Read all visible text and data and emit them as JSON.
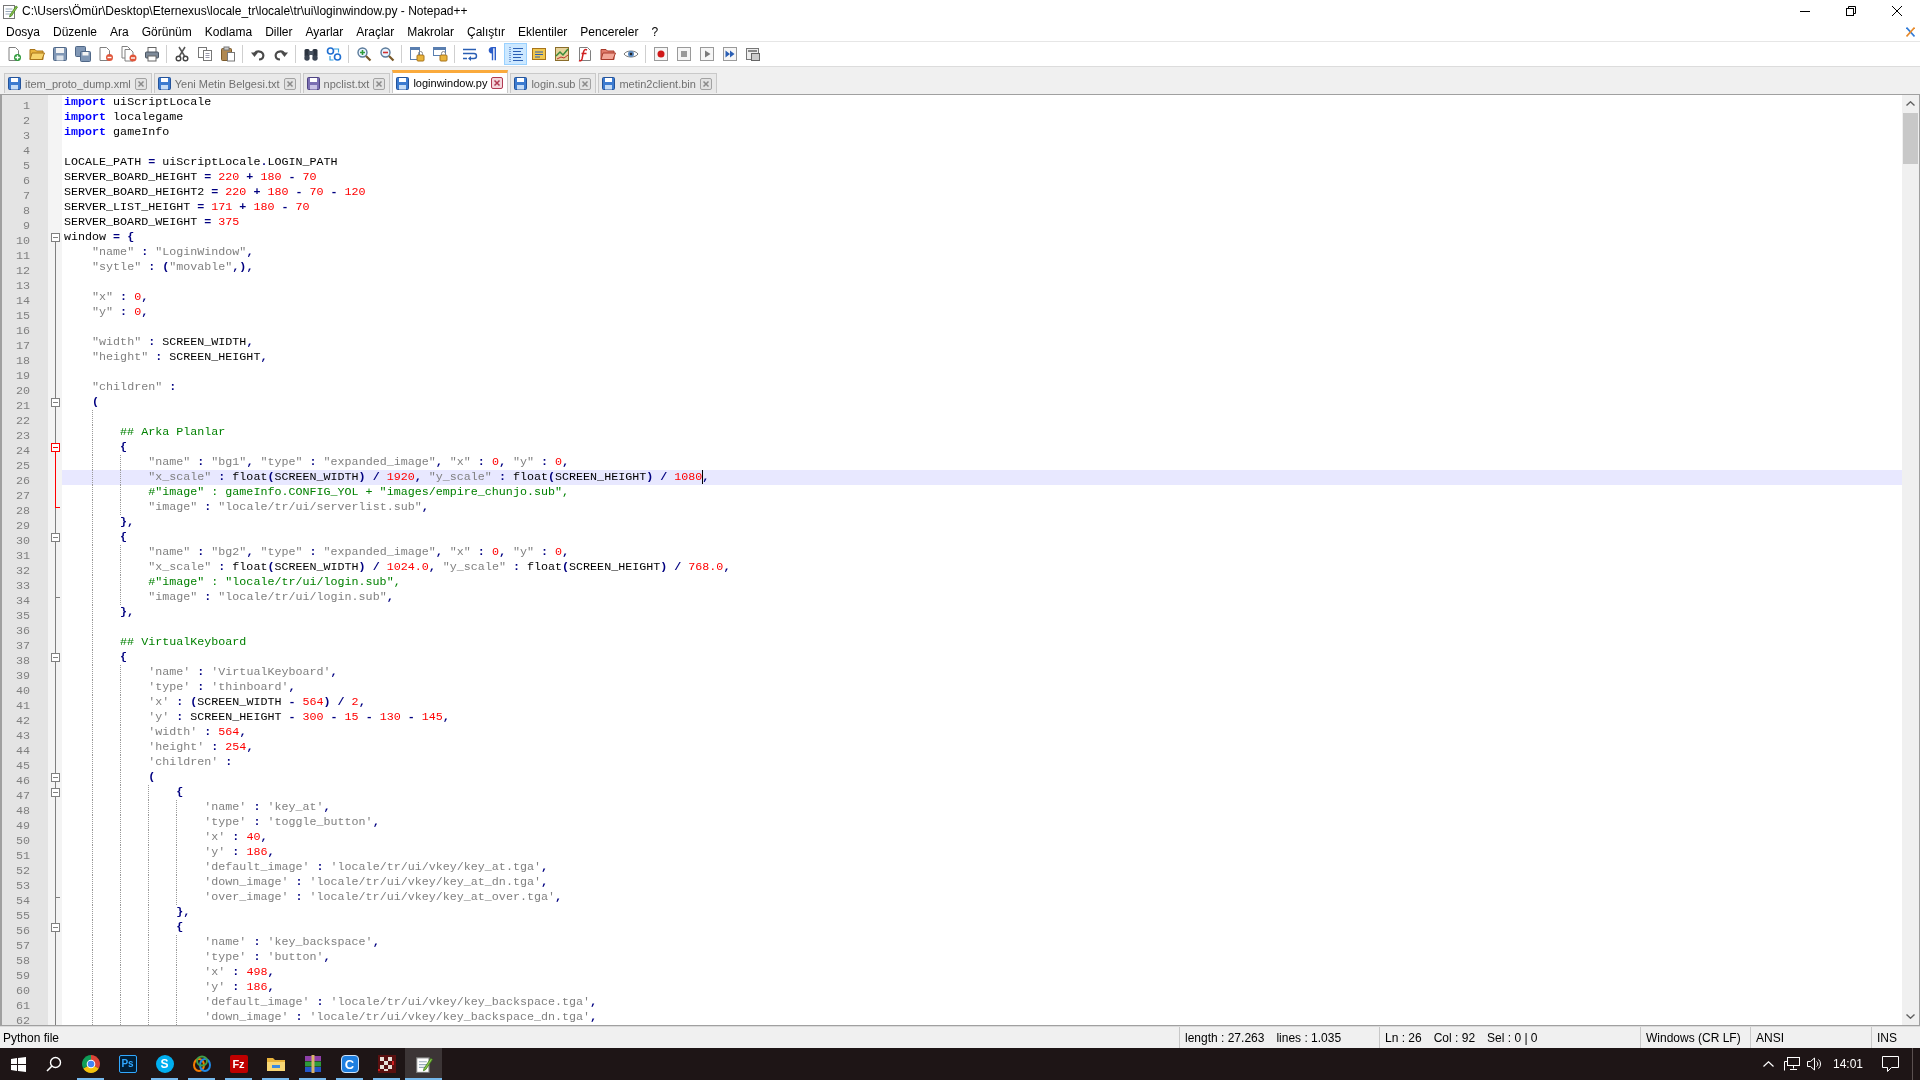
{
  "window": {
    "title": "C:\\Users\\Ömür\\Desktop\\Eternexus\\locale_tr\\locale\\tr\\ui\\loginwindow.py - Notepad++"
  },
  "menu": [
    "Dosya",
    "Düzenle",
    "Ara",
    "Görünüm",
    "Kodlama",
    "Diller",
    "Ayarlar",
    "Araçlar",
    "Makrolar",
    "Çalıştır",
    "Eklentiler",
    "Pencereler",
    "?"
  ],
  "toolbar": {
    "buttons": [
      {
        "kind": "icon",
        "selected": false
      },
      {
        "kind": "icon",
        "selected": false
      },
      {
        "kind": "icon",
        "selected": false
      },
      {
        "kind": "icon",
        "selected": false
      },
      {
        "kind": "icon",
        "selected": false
      },
      {
        "kind": "icon",
        "selected": false
      },
      {
        "kind": "icon",
        "selected": false
      },
      {
        "kind": "icon",
        "selected": false
      },
      {
        "kind": "icon",
        "selected": false
      },
      {
        "kind": "icon",
        "selected": false
      },
      {
        "kind": "icon",
        "selected": false
      },
      {
        "kind": "icon",
        "selected": false
      },
      {
        "kind": "icon",
        "selected": false
      },
      {
        "kind": "icon",
        "selected": false
      },
      {
        "kind": "icon",
        "selected": false
      },
      {
        "kind": "icon",
        "selected": false
      },
      {
        "kind": "icon",
        "selected": false
      },
      {
        "kind": "icon",
        "selected": false
      },
      {
        "kind": "icon",
        "selected": false
      },
      {
        "kind": "glyph",
        "text": "¶",
        "selected": false
      },
      {
        "kind": "icon",
        "selected": true
      },
      {
        "kind": "icon",
        "selected": false
      },
      {
        "kind": "icon",
        "selected": false
      },
      {
        "kind": "icon",
        "selected": false
      },
      {
        "kind": "icon",
        "selected": false
      },
      {
        "kind": "icon",
        "selected": false
      },
      {
        "kind": "icon",
        "selected": false
      },
      {
        "kind": "icon",
        "selected": false
      },
      {
        "kind": "icon",
        "selected": false
      },
      {
        "kind": "icon",
        "selected": false
      },
      {
        "kind": "icon",
        "selected": false
      }
    ]
  },
  "tabs": [
    {
      "label": "item_proto_dump.xml",
      "selected": false,
      "read_only": false
    },
    {
      "label": "Yeni Metin Belgesi.txt",
      "selected": false,
      "read_only": false
    },
    {
      "label": "npclist.txt",
      "selected": false,
      "read_only": true
    },
    {
      "label": "loginwindow.py",
      "selected": true,
      "read_only": false
    },
    {
      "label": "login.sub",
      "selected": false,
      "read_only": false
    },
    {
      "label": "metin2client.bin",
      "selected": false,
      "read_only": false
    }
  ],
  "editor": {
    "lines": [
      {
        "number": "1",
        "kind": "plain",
        "current": false,
        "tokens": [
          {
            "kind": "kw",
            "text": "import"
          },
          {
            "kind": "id",
            "text": " uiScriptLocale"
          }
        ]
      },
      {
        "number": "2",
        "kind": "plain",
        "current": false,
        "tokens": [
          {
            "kind": "kw",
            "text": "import"
          },
          {
            "kind": "id",
            "text": " localegame"
          }
        ]
      },
      {
        "number": "3",
        "kind": "plain",
        "current": false,
        "tokens": [
          {
            "kind": "kw",
            "text": "import"
          },
          {
            "kind": "id",
            "text": " gameInfo"
          }
        ]
      },
      {
        "number": "4",
        "kind": "plain",
        "current": false
      },
      {
        "number": "5",
        "kind": "plain",
        "current": false,
        "tokens": [
          {
            "kind": "id",
            "text": "LOCALE_PATH"
          },
          {
            "kind": "op",
            "text": " = "
          },
          {
            "kind": "id",
            "text": "uiScriptLocale"
          },
          {
            "kind": "op",
            "text": "."
          },
          {
            "kind": "id",
            "text": "LOGIN_PATH"
          }
        ]
      },
      {
        "number": "6",
        "kind": "plain",
        "current": false,
        "tokens": [
          {
            "kind": "id",
            "text": "SERVER_BOARD_HEIGHT"
          },
          {
            "kind": "op",
            "text": " = "
          },
          {
            "kind": "num",
            "text": "220"
          },
          {
            "kind": "op",
            "text": " + "
          },
          {
            "kind": "num",
            "text": "180"
          },
          {
            "kind": "op",
            "text": " - "
          },
          {
            "kind": "num",
            "text": "70"
          }
        ]
      },
      {
        "number": "7",
        "kind": "plain",
        "current": false,
        "tokens": [
          {
            "kind": "id",
            "text": "SERVER_BOARD_HEIGHT2"
          },
          {
            "kind": "op",
            "text": " = "
          },
          {
            "kind": "num",
            "text": "220"
          },
          {
            "kind": "op",
            "text": " + "
          },
          {
            "kind": "num",
            "text": "180"
          },
          {
            "kind": "op",
            "text": " - "
          },
          {
            "kind": "num",
            "text": "70"
          },
          {
            "kind": "op",
            "text": " - "
          },
          {
            "kind": "num",
            "text": "120"
          }
        ]
      },
      {
        "number": "8",
        "kind": "plain",
        "current": false,
        "tokens": [
          {
            "kind": "id",
            "text": "SERVER_LIST_HEIGHT"
          },
          {
            "kind": "op",
            "text": " = "
          },
          {
            "kind": "num",
            "text": "171"
          },
          {
            "kind": "op",
            "text": " + "
          },
          {
            "kind": "num",
            "text": "180"
          },
          {
            "kind": "op",
            "text": " - "
          },
          {
            "kind": "num",
            "text": "70"
          }
        ]
      },
      {
        "number": "9",
        "kind": "plain",
        "current": false,
        "tokens": [
          {
            "kind": "id",
            "text": "SERVER_BOARD_WEIGHT"
          },
          {
            "kind": "op",
            "text": " = "
          },
          {
            "kind": "num",
            "text": "375"
          }
        ]
      },
      {
        "number": "10",
        "kind": "foldstart",
        "fold_highlight": false,
        "current": false,
        "tokens": [
          {
            "kind": "id",
            "text": "window"
          },
          {
            "kind": "op",
            "text": " = {"
          }
        ]
      },
      {
        "number": "11",
        "kind": "foldline",
        "fold_highlight": false,
        "current": false,
        "tokens": [
          {
            "kind": "str",
            "text": "    \"name\""
          },
          {
            "kind": "op",
            "text": " : "
          },
          {
            "kind": "str",
            "text": "\"LoginWindow\""
          },
          {
            "kind": "op",
            "text": ","
          }
        ]
      },
      {
        "number": "12",
        "kind": "foldline",
        "fold_highlight": false,
        "current": false,
        "tokens": [
          {
            "kind": "str",
            "text": "    \"sytle\""
          },
          {
            "kind": "op",
            "text": " : ("
          },
          {
            "kind": "str",
            "text": "\"movable\""
          },
          {
            "kind": "op",
            "text": ",),"
          }
        ]
      },
      {
        "number": "13",
        "kind": "foldline",
        "fold_highlight": false,
        "current": false
      },
      {
        "number": "14",
        "kind": "foldline",
        "fold_highlight": false,
        "current": false,
        "tokens": [
          {
            "kind": "str",
            "text": "    \"x\""
          },
          {
            "kind": "op",
            "text": " : "
          },
          {
            "kind": "num",
            "text": "0"
          },
          {
            "kind": "op",
            "text": ","
          }
        ]
      },
      {
        "number": "15",
        "kind": "foldline",
        "fold_highlight": false,
        "current": false,
        "tokens": [
          {
            "kind": "str",
            "text": "    \"y\""
          },
          {
            "kind": "op",
            "text": " : "
          },
          {
            "kind": "num",
            "text": "0"
          },
          {
            "kind": "op",
            "text": ","
          }
        ]
      },
      {
        "number": "16",
        "kind": "foldline",
        "fold_highlight": false,
        "current": false
      },
      {
        "number": "17",
        "kind": "foldline",
        "fold_highlight": false,
        "current": false,
        "tokens": [
          {
            "kind": "str",
            "text": "    \"width\""
          },
          {
            "kind": "op",
            "text": " : "
          },
          {
            "kind": "id",
            "text": "SCREEN_WIDTH"
          },
          {
            "kind": "op",
            "text": ","
          }
        ]
      },
      {
        "number": "18",
        "kind": "foldline",
        "fold_highlight": false,
        "current": false,
        "tokens": [
          {
            "kind": "str",
            "text": "    \"height\""
          },
          {
            "kind": "op",
            "text": " : "
          },
          {
            "kind": "id",
            "text": "SCREEN_HEIGHT"
          },
          {
            "kind": "op",
            "text": ","
          }
        ]
      },
      {
        "number": "19",
        "kind": "foldline",
        "fold_highlight": false,
        "current": false
      },
      {
        "number": "20",
        "kind": "foldline",
        "fold_highlight": false,
        "current": false,
        "tokens": [
          {
            "kind": "str",
            "text": "    \"children\""
          },
          {
            "kind": "op",
            "text": " :"
          }
        ]
      },
      {
        "number": "21",
        "kind": "foldstart",
        "fold_highlight": false,
        "current": false,
        "tokens": [
          {
            "kind": "op",
            "text": "    ("
          }
        ]
      },
      {
        "number": "22",
        "kind": "foldline",
        "fold_highlight": false,
        "current": false
      },
      {
        "number": "23",
        "kind": "foldline",
        "fold_highlight": false,
        "current": false,
        "tokens": [
          {
            "kind": "cmt",
            "text": "        ## Arka Planlar"
          }
        ]
      },
      {
        "number": "24",
        "kind": "foldstart",
        "fold_highlight": true,
        "current": false,
        "tokens": [
          {
            "kind": "op",
            "text": "        {"
          }
        ]
      },
      {
        "number": "25",
        "kind": "foldline",
        "fold_highlight": true,
        "current": false,
        "tokens": [
          {
            "kind": "str",
            "text": "            \"name\""
          },
          {
            "kind": "op",
            "text": " : "
          },
          {
            "kind": "str",
            "text": "\"bg1\""
          },
          {
            "kind": "op",
            "text": ", "
          },
          {
            "kind": "str",
            "text": "\"type\""
          },
          {
            "kind": "op",
            "text": " : "
          },
          {
            "kind": "str",
            "text": "\"expanded_image\""
          },
          {
            "kind": "op",
            "text": ", "
          },
          {
            "kind": "str",
            "text": "\"x\""
          },
          {
            "kind": "op",
            "text": " : "
          },
          {
            "kind": "num",
            "text": "0"
          },
          {
            "kind": "op",
            "text": ", "
          },
          {
            "kind": "str",
            "text": "\"y\""
          },
          {
            "kind": "op",
            "text": " : "
          },
          {
            "kind": "num",
            "text": "0"
          },
          {
            "kind": "op",
            "text": ","
          }
        ]
      },
      {
        "number": "26",
        "kind": "foldline",
        "fold_highlight": true,
        "current": true,
        "tokens": [
          {
            "kind": "str",
            "text": "            \"x_scale\""
          },
          {
            "kind": "op",
            "text": " : "
          },
          {
            "kind": "id",
            "text": "float"
          },
          {
            "kind": "op",
            "text": "("
          },
          {
            "kind": "id",
            "text": "SCREEN_WIDTH"
          },
          {
            "kind": "op",
            "text": ") / "
          },
          {
            "kind": "num",
            "text": "1920"
          },
          {
            "kind": "op",
            "text": ", "
          },
          {
            "kind": "str",
            "text": "\"y_scale\""
          },
          {
            "kind": "op",
            "text": " : "
          },
          {
            "kind": "id",
            "text": "float"
          },
          {
            "kind": "op",
            "text": "("
          },
          {
            "kind": "id",
            "text": "SCREEN_HEIGHT"
          },
          {
            "kind": "op",
            "text": ") / "
          },
          {
            "kind": "num",
            "text": "1080"
          },
          {
            "kind": "caret"
          },
          {
            "kind": "op",
            "text": ","
          }
        ]
      },
      {
        "number": "27",
        "kind": "foldline",
        "fold_highlight": true,
        "current": false,
        "tokens": [
          {
            "kind": "cmt",
            "text": "            #\"image\" : gameInfo.CONFIG_YOL + \"images/empire_chunjo.sub\","
          }
        ]
      },
      {
        "number": "28",
        "kind": "foldend",
        "fold_highlight": true,
        "current": false,
        "tokens": [
          {
            "kind": "str",
            "text": "            \"image\""
          },
          {
            "kind": "op",
            "text": " : "
          },
          {
            "kind": "str",
            "text": "\"locale/tr/ui/serverlist.sub\""
          },
          {
            "kind": "op",
            "text": ","
          }
        ]
      },
      {
        "number": "29",
        "kind": "foldline",
        "fold_highlight": false,
        "current": false,
        "tokens": [
          {
            "kind": "op",
            "text": "        },"
          }
        ]
      },
      {
        "number": "30",
        "kind": "foldstart",
        "fold_highlight": false,
        "current": false,
        "tokens": [
          {
            "kind": "op",
            "text": "        {"
          }
        ]
      },
      {
        "number": "31",
        "kind": "foldline",
        "fold_highlight": false,
        "current": false,
        "tokens": [
          {
            "kind": "str",
            "text": "            \"name\""
          },
          {
            "kind": "op",
            "text": " : "
          },
          {
            "kind": "str",
            "text": "\"bg2\""
          },
          {
            "kind": "op",
            "text": ", "
          },
          {
            "kind": "str",
            "text": "\"type\""
          },
          {
            "kind": "op",
            "text": " : "
          },
          {
            "kind": "str",
            "text": "\"expanded_image\""
          },
          {
            "kind": "op",
            "text": ", "
          },
          {
            "kind": "str",
            "text": "\"x\""
          },
          {
            "kind": "op",
            "text": " : "
          },
          {
            "kind": "num",
            "text": "0"
          },
          {
            "kind": "op",
            "text": ", "
          },
          {
            "kind": "str",
            "text": "\"y\""
          },
          {
            "kind": "op",
            "text": " : "
          },
          {
            "kind": "num",
            "text": "0"
          },
          {
            "kind": "op",
            "text": ","
          }
        ]
      },
      {
        "number": "32",
        "kind": "foldline",
        "fold_highlight": false,
        "current": false,
        "tokens": [
          {
            "kind": "str",
            "text": "            \"x_scale\""
          },
          {
            "kind": "op",
            "text": " : "
          },
          {
            "kind": "id",
            "text": "float"
          },
          {
            "kind": "op",
            "text": "("
          },
          {
            "kind": "id",
            "text": "SCREEN_WIDTH"
          },
          {
            "kind": "op",
            "text": ") / "
          },
          {
            "kind": "num",
            "text": "1024.0"
          },
          {
            "kind": "op",
            "text": ", "
          },
          {
            "kind": "str",
            "text": "\"y_scale\""
          },
          {
            "kind": "op",
            "text": " : "
          },
          {
            "kind": "id",
            "text": "float"
          },
          {
            "kind": "op",
            "text": "("
          },
          {
            "kind": "id",
            "text": "SCREEN_HEIGHT"
          },
          {
            "kind": "op",
            "text": ") / "
          },
          {
            "kind": "num",
            "text": "768.0"
          },
          {
            "kind": "op",
            "text": ","
          }
        ]
      },
      {
        "number": "33",
        "kind": "foldline",
        "fold_highlight": false,
        "current": false,
        "tokens": [
          {
            "kind": "cmt",
            "text": "            #\"image\" : \"locale/tr/ui/login.sub\","
          }
        ]
      },
      {
        "number": "34",
        "kind": "foldend",
        "fold_highlight": false,
        "current": false,
        "tokens": [
          {
            "kind": "str",
            "text": "            \"image\""
          },
          {
            "kind": "op",
            "text": " : "
          },
          {
            "kind": "str",
            "text": "\"locale/tr/ui/login.sub\""
          },
          {
            "kind": "op",
            "text": ","
          }
        ]
      },
      {
        "number": "35",
        "kind": "foldline",
        "fold_highlight": false,
        "current": false,
        "tokens": [
          {
            "kind": "op",
            "text": "        },"
          }
        ]
      },
      {
        "number": "36",
        "kind": "foldline",
        "fold_highlight": false,
        "current": false
      },
      {
        "number": "37",
        "kind": "foldline",
        "fold_highlight": false,
        "current": false,
        "tokens": [
          {
            "kind": "cmt",
            "text": "        ## VirtualKeyboard"
          }
        ]
      },
      {
        "number": "38",
        "kind": "foldstart",
        "fold_highlight": false,
        "current": false,
        "tokens": [
          {
            "kind": "op",
            "text": "        {"
          }
        ]
      },
      {
        "number": "39",
        "kind": "foldline",
        "fold_highlight": false,
        "current": false,
        "tokens": [
          {
            "kind": "str",
            "text": "            'name'"
          },
          {
            "kind": "op",
            "text": " : "
          },
          {
            "kind": "str",
            "text": "'VirtualKeyboard'"
          },
          {
            "kind": "op",
            "text": ","
          }
        ]
      },
      {
        "number": "40",
        "kind": "foldline",
        "fold_highlight": false,
        "current": false,
        "tokens": [
          {
            "kind": "str",
            "text": "            'type'"
          },
          {
            "kind": "op",
            "text": " : "
          },
          {
            "kind": "str",
            "text": "'thinboard'"
          },
          {
            "kind": "op",
            "text": ","
          }
        ]
      },
      {
        "number": "41",
        "kind": "foldline",
        "fold_highlight": false,
        "current": false,
        "tokens": [
          {
            "kind": "str",
            "text": "            'x'"
          },
          {
            "kind": "op",
            "text": " : ("
          },
          {
            "kind": "id",
            "text": "SCREEN_WIDTH"
          },
          {
            "kind": "op",
            "text": " - "
          },
          {
            "kind": "num",
            "text": "564"
          },
          {
            "kind": "op",
            "text": ") / "
          },
          {
            "kind": "num",
            "text": "2"
          },
          {
            "kind": "op",
            "text": ","
          }
        ]
      },
      {
        "number": "42",
        "kind": "foldline",
        "fold_highlight": false,
        "current": false,
        "tokens": [
          {
            "kind": "str",
            "text": "            'y'"
          },
          {
            "kind": "op",
            "text": " : "
          },
          {
            "kind": "id",
            "text": "SCREEN_HEIGHT"
          },
          {
            "kind": "op",
            "text": " - "
          },
          {
            "kind": "num",
            "text": "300"
          },
          {
            "kind": "op",
            "text": " - "
          },
          {
            "kind": "num",
            "text": "15"
          },
          {
            "kind": "op",
            "text": " - "
          },
          {
            "kind": "num",
            "text": "130"
          },
          {
            "kind": "op",
            "text": " - "
          },
          {
            "kind": "num",
            "text": "145"
          },
          {
            "kind": "op",
            "text": ","
          }
        ]
      },
      {
        "number": "43",
        "kind": "foldline",
        "fold_highlight": false,
        "current": false,
        "tokens": [
          {
            "kind": "str",
            "text": "            'width'"
          },
          {
            "kind": "op",
            "text": " : "
          },
          {
            "kind": "num",
            "text": "564"
          },
          {
            "kind": "op",
            "text": ","
          }
        ]
      },
      {
        "number": "44",
        "kind": "foldline",
        "fold_highlight": false,
        "current": false,
        "tokens": [
          {
            "kind": "str",
            "text": "            'height'"
          },
          {
            "kind": "op",
            "text": " : "
          },
          {
            "kind": "num",
            "text": "254"
          },
          {
            "kind": "op",
            "text": ","
          }
        ]
      },
      {
        "number": "45",
        "kind": "foldline",
        "fold_highlight": false,
        "current": false,
        "tokens": [
          {
            "kind": "str",
            "text": "            'children'"
          },
          {
            "kind": "op",
            "text": " :"
          }
        ]
      },
      {
        "number": "46",
        "kind": "foldstart",
        "fold_highlight": false,
        "current": false,
        "tokens": [
          {
            "kind": "op",
            "text": "            ("
          }
        ]
      },
      {
        "number": "47",
        "kind": "foldstart",
        "fold_highlight": false,
        "current": false,
        "tokens": [
          {
            "kind": "op",
            "text": "                {"
          }
        ]
      },
      {
        "number": "48",
        "kind": "foldline",
        "fold_highlight": false,
        "current": false,
        "tokens": [
          {
            "kind": "str",
            "text": "                    'name'"
          },
          {
            "kind": "op",
            "text": " : "
          },
          {
            "kind": "str",
            "text": "'key_at'"
          },
          {
            "kind": "op",
            "text": ","
          }
        ]
      },
      {
        "number": "49",
        "kind": "foldline",
        "fold_highlight": false,
        "current": false,
        "tokens": [
          {
            "kind": "str",
            "text": "                    'type'"
          },
          {
            "kind": "op",
            "text": " : "
          },
          {
            "kind": "str",
            "text": "'toggle_button'"
          },
          {
            "kind": "op",
            "text": ","
          }
        ]
      },
      {
        "number": "50",
        "kind": "foldline",
        "fold_highlight": false,
        "current": false,
        "tokens": [
          {
            "kind": "str",
            "text": "                    'x'"
          },
          {
            "kind": "op",
            "text": " : "
          },
          {
            "kind": "num",
            "text": "40"
          },
          {
            "kind": "op",
            "text": ","
          }
        ]
      },
      {
        "number": "51",
        "kind": "foldline",
        "fold_highlight": false,
        "current": false,
        "tokens": [
          {
            "kind": "str",
            "text": "                    'y'"
          },
          {
            "kind": "op",
            "text": " : "
          },
          {
            "kind": "num",
            "text": "186"
          },
          {
            "kind": "op",
            "text": ","
          }
        ]
      },
      {
        "number": "52",
        "kind": "foldline",
        "fold_highlight": false,
        "current": false,
        "tokens": [
          {
            "kind": "str",
            "text": "                    'default_image'"
          },
          {
            "kind": "op",
            "text": " : "
          },
          {
            "kind": "str",
            "text": "'locale/tr/ui/vkey/key_at.tga'"
          },
          {
            "kind": "op",
            "text": ","
          }
        ]
      },
      {
        "number": "53",
        "kind": "foldline",
        "fold_highlight": false,
        "current": false,
        "tokens": [
          {
            "kind": "str",
            "text": "                    'down_image'"
          },
          {
            "kind": "op",
            "text": " : "
          },
          {
            "kind": "str",
            "text": "'locale/tr/ui/vkey/key_at_dn.tga'"
          },
          {
            "kind": "op",
            "text": ","
          }
        ]
      },
      {
        "number": "54",
        "kind": "foldend",
        "fold_highlight": false,
        "current": false,
        "tokens": [
          {
            "kind": "str",
            "text": "                    'over_image'"
          },
          {
            "kind": "op",
            "text": " : "
          },
          {
            "kind": "str",
            "text": "'locale/tr/ui/vkey/key_at_over.tga'"
          },
          {
            "kind": "op",
            "text": ","
          }
        ]
      },
      {
        "number": "55",
        "kind": "foldline",
        "fold_highlight": false,
        "current": false,
        "tokens": [
          {
            "kind": "op",
            "text": "                },"
          }
        ]
      },
      {
        "number": "56",
        "kind": "foldstart",
        "fold_highlight": false,
        "current": false,
        "tokens": [
          {
            "kind": "op",
            "text": "                {"
          }
        ]
      },
      {
        "number": "57",
        "kind": "foldline",
        "fold_highlight": false,
        "current": false,
        "tokens": [
          {
            "kind": "str",
            "text": "                    'name'"
          },
          {
            "kind": "op",
            "text": " : "
          },
          {
            "kind": "str",
            "text": "'key_backspace'"
          },
          {
            "kind": "op",
            "text": ","
          }
        ]
      },
      {
        "number": "58",
        "kind": "foldline",
        "fold_highlight": false,
        "current": false,
        "tokens": [
          {
            "kind": "str",
            "text": "                    'type'"
          },
          {
            "kind": "op",
            "text": " : "
          },
          {
            "kind": "str",
            "text": "'button'"
          },
          {
            "kind": "op",
            "text": ","
          }
        ]
      },
      {
        "number": "59",
        "kind": "foldline",
        "fold_highlight": false,
        "current": false,
        "tokens": [
          {
            "kind": "str",
            "text": "                    'x'"
          },
          {
            "kind": "op",
            "text": " : "
          },
          {
            "kind": "num",
            "text": "498"
          },
          {
            "kind": "op",
            "text": ","
          }
        ]
      },
      {
        "number": "60",
        "kind": "foldline",
        "fold_highlight": false,
        "current": false,
        "tokens": [
          {
            "kind": "str",
            "text": "                    'y'"
          },
          {
            "kind": "op",
            "text": " : "
          },
          {
            "kind": "num",
            "text": "186"
          },
          {
            "kind": "op",
            "text": ","
          }
        ]
      },
      {
        "number": "61",
        "kind": "foldline",
        "fold_highlight": false,
        "current": false,
        "tokens": [
          {
            "kind": "str",
            "text": "                    'default_image'"
          },
          {
            "kind": "op",
            "text": " : "
          },
          {
            "kind": "str",
            "text": "'locale/tr/ui/vkey/key_backspace.tga'"
          },
          {
            "kind": "op",
            "text": ","
          }
        ]
      },
      {
        "number": "62",
        "kind": "foldline",
        "fold_highlight": false,
        "current": false,
        "tokens": [
          {
            "kind": "str",
            "text": "                    'down_image'"
          },
          {
            "kind": "op",
            "text": " : "
          },
          {
            "kind": "str",
            "text": "'locale/tr/ui/vkey/key_backspace_dn.tga'"
          },
          {
            "kind": "op",
            "text": ","
          }
        ]
      }
    ]
  },
  "status_bar": {
    "file_type": "Python file",
    "length": "length : 27.263",
    "lines": "lines : 1.035",
    "line": "Ln : 26",
    "column": "Col : 92",
    "selection": "Sel : 0 | 0",
    "line_ending": "Windows (CR LF)",
    "encoding": "ANSI",
    "mode": "INS"
  },
  "taskbar": {
    "apps": [
      {
        "running": true,
        "active": false
      },
      {
        "running": false,
        "active": false,
        "glyph": "Ps"
      },
      {
        "running": true,
        "active": false,
        "glyph": "S"
      },
      {
        "running": true,
        "active": false
      },
      {
        "running": true,
        "active": false,
        "glyph": "Fz"
      },
      {
        "running": true,
        "active": false
      },
      {
        "running": true,
        "active": false
      },
      {
        "running": true,
        "active": false,
        "glyph": "C"
      },
      {
        "running": true,
        "active": false
      },
      {
        "running": true,
        "active": true
      }
    ],
    "tray": {
      "time": "14:01"
    }
  }
}
